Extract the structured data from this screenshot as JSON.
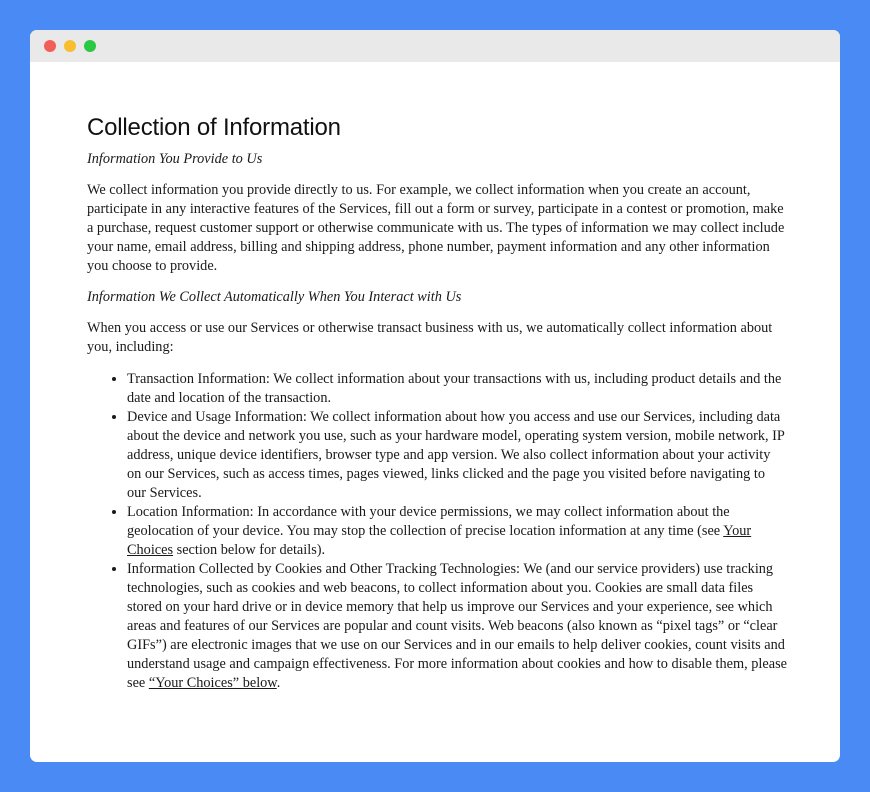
{
  "window": {
    "controls": [
      "close",
      "minimize",
      "maximize"
    ]
  },
  "page": {
    "title": "Collection of Information",
    "subhead_1": "Information You Provide to Us",
    "para_1": "We collect information you provide directly to us. For example, we collect information when you create an account, participate in any interactive features of the Services, fill out a form or survey, participate in a contest or promotion, make a purchase, request customer support or otherwise communicate with us. The types of information we may collect include your name, email address, billing and shipping address, phone number, payment information and any other information you choose to provide.",
    "subhead_2": "Information We Collect Automatically When You Interact with Us",
    "para_2": "When you access or use our Services or otherwise transact business with us, we automatically collect information about you, including:",
    "bullets": {
      "item_1": "Transaction Information: We collect information about your transactions with us, including product details and the date and location of the transaction.",
      "item_2": "Device and Usage Information: We collect information about how you access and use our Services, including data about the device and network you use, such as your hardware model, operating system version, mobile network, IP address, unique device identifiers, browser type and app version. We also collect information about your activity on our Services, such as access times, pages viewed, links clicked and the page you visited before navigating to our Services.",
      "item_3_before": "Location Information: In accordance with your device permissions, we may collect information about the geolocation of your device. You may stop the collection of precise location information at any time (see ",
      "item_3_link": "Your Choices",
      "item_3_after": " section below for details).",
      "item_4_before": "Information Collected by Cookies and Other Tracking Technologies: We (and our service providers) use tracking technologies, such as cookies and web beacons, to collect information about you. Cookies are small data files stored on your hard drive or in device memory that help us improve our Services and your experience, see which areas and features of our Services are popular and count visits. Web beacons (also known as “pixel tags” or “clear GIFs”) are electronic images that we use on our Services and in our emails to help deliver cookies, count visits and understand usage and campaign effectiveness. For more information about cookies and how to disable them, please see ",
      "item_4_link": "“Your Choices” below",
      "item_4_after": "."
    }
  },
  "colors": {
    "background": "#4a8af4",
    "titlebar": "#e9e9e9",
    "close": "#f25f58",
    "minimize": "#f9be2f",
    "maximize": "#2ac843"
  }
}
